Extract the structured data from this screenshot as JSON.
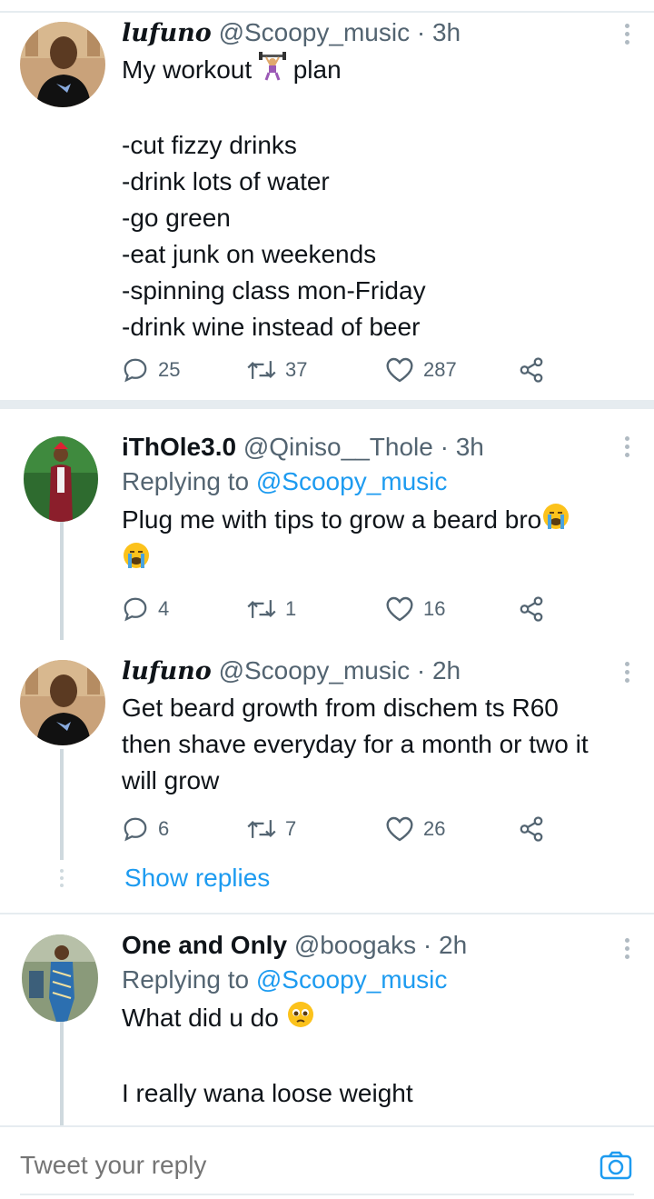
{
  "tweets": [
    {
      "name": "lufuno",
      "handle": "@Scoopy_music",
      "dot": "·",
      "time": "3h",
      "text_lines": [
        "My workout ",
        " plan",
        "",
        "-cut fizzy drinks",
        "-drink lots of water",
        "-go green",
        "-eat junk on weekends",
        "-spinning class mon-Friday",
        "-drink wine instead of beer"
      ],
      "replies": "25",
      "retweets": "37",
      "likes": "287"
    },
    {
      "name": "iThOle3.0",
      "handle": "@Qiniso__Thole",
      "dot": "·",
      "time": "3h",
      "replying_prefix": "Replying to",
      "replying_to": "@Scoopy_music",
      "text": "Plug me with tips to grow a beard bro",
      "replies": "4",
      "retweets": "1",
      "likes": "16"
    },
    {
      "name": "lufuno",
      "handle": "@Scoopy_music",
      "dot": "·",
      "time": "2h",
      "text_lines": [
        "Get beard growth from dischem ts R60",
        "then shave everyday for a month or two it",
        "will grow"
      ],
      "replies": "6",
      "retweets": "7",
      "likes": "26"
    },
    {
      "name": "One and Only",
      "handle": "@boogaks",
      "dot": "·",
      "time": "2h",
      "replying_prefix": "Replying to",
      "replying_to": "@Scoopy_music",
      "text_lines": [
        "What did u do ",
        "",
        "I really wana loose weight"
      ]
    }
  ],
  "show_replies": "Show replies",
  "composer": {
    "placeholder": "Tweet your reply"
  },
  "icons": {
    "reply": "reply-icon",
    "retweet": "retweet-icon",
    "like": "heart-icon",
    "share": "share-icon",
    "more": "more-vertical-icon",
    "camera": "camera-icon",
    "weightlifter": "person-lifting-weights-emoji",
    "crying": "loudly-crying-face-emoji",
    "pleading": "pleading-face-emoji"
  },
  "colors": {
    "accent": "#1d9bf0",
    "secondary_text": "#536471",
    "divider": "#e6ecf0"
  }
}
